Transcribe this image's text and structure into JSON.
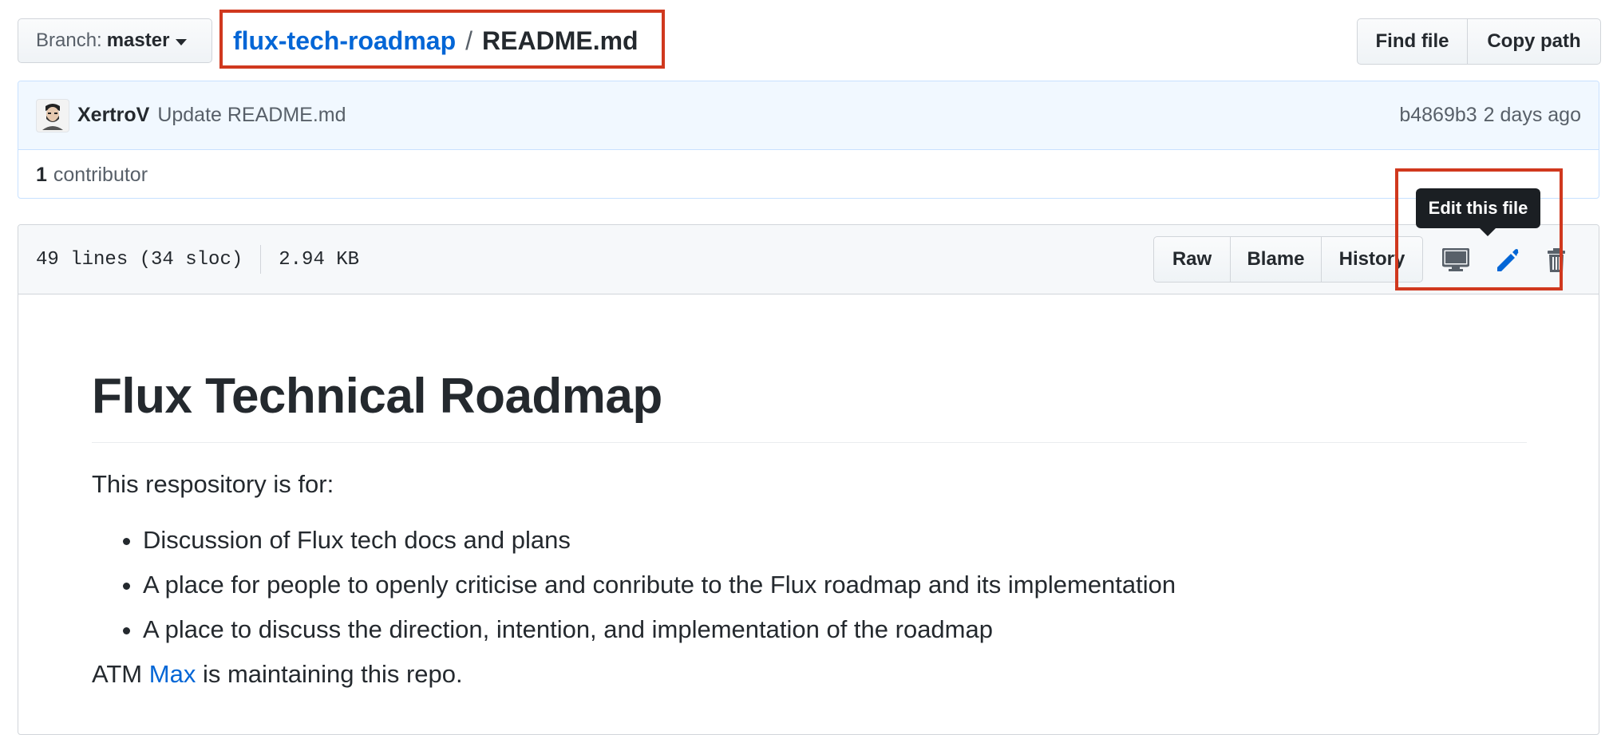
{
  "branch": {
    "prefix": "Branch:",
    "name": "master"
  },
  "breadcrumb": {
    "repo": "flux-tech-roadmap",
    "separator": "/",
    "file": "README.md"
  },
  "file_nav": {
    "find_file": "Find file",
    "copy_path": "Copy path"
  },
  "commit": {
    "author": "XertroV",
    "message": "Update README.md",
    "sha": "b4869b3",
    "time": "2 days ago",
    "contributors_count": "1",
    "contributors_label": "contributor"
  },
  "file_info": {
    "lines": "49 lines (34 sloc)",
    "size": "2.94 KB"
  },
  "file_actions": {
    "raw": "Raw",
    "blame": "Blame",
    "history": "History",
    "icons": [
      "desktop-icon",
      "pencil-icon",
      "trashcan-icon"
    ]
  },
  "tooltip": {
    "text": "Edit this file"
  },
  "readme": {
    "title": "Flux Technical Roadmap",
    "intro": "This respository is for:",
    "items": [
      "Discussion of Flux tech docs and plans",
      "A place for people to openly criticise and conribute to the Flux roadmap and its implementation",
      "A place to discuss the direction, intention, and implementation of the roadmap"
    ],
    "maintainer_prefix": "ATM",
    "maintainer_link": "Max",
    "maintainer_suffix": "is maintaining this repo."
  },
  "colors": {
    "link": "#0366d6",
    "highlight": "#d0381e",
    "tooltip_bg": "#1b1f23"
  }
}
